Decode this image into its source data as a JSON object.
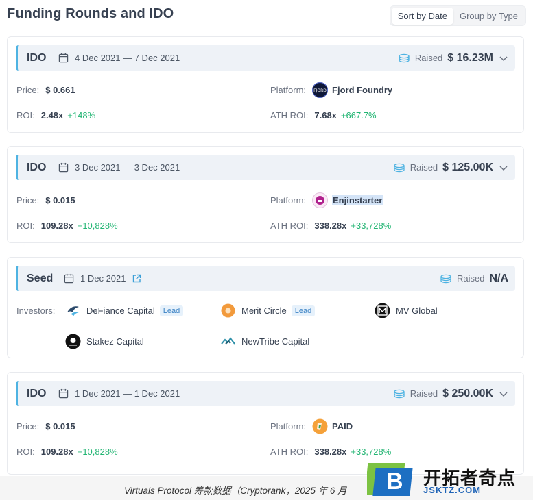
{
  "page": {
    "title": "Funding Rounds and IDO",
    "sort_by_date": "Sort by Date",
    "group_by_type": "Group by Type"
  },
  "rounds": [
    {
      "type": "IDO",
      "date": "4 Dec 2021 — 7 Dec 2021",
      "raised_label": "Raised",
      "raised_value": "$ 16.23M",
      "price_label": "Price:",
      "price": "$ 0.661",
      "platform_label": "Platform:",
      "platform": "Fjord Foundry",
      "roi_label": "ROI:",
      "roi": "2.48x",
      "roi_pct": "+148%",
      "ath_label": "ATH ROI:",
      "ath_roi": "7.68x",
      "ath_pct": "+667.7%"
    },
    {
      "type": "IDO",
      "date": "3 Dec 2021 — 3 Dec 2021",
      "raised_label": "Raised",
      "raised_value": "$ 125.00K",
      "price_label": "Price:",
      "price": "$ 0.015",
      "platform_label": "Platform:",
      "platform": "Enjinstarter",
      "roi_label": "ROI:",
      "roi": "109.28x",
      "roi_pct": "+10,828%",
      "ath_label": "ATH ROI:",
      "ath_roi": "338.28x",
      "ath_pct": "+33,728%"
    },
    {
      "type": "Seed",
      "date": "1 Dec 2021",
      "raised_label": "Raised",
      "raised_value": "N/A",
      "investors_label": "Investors:",
      "lead_label": "Lead",
      "investors": [
        "DeFiance Capital",
        "Merit Circle",
        "MV Global",
        "Stakez Capital",
        "NewTribe Capital"
      ]
    },
    {
      "type": "IDO",
      "date": "1 Dec 2021 — 1 Dec 2021",
      "raised_label": "Raised",
      "raised_value": "$ 250.00K",
      "price_label": "Price:",
      "price": "$ 0.015",
      "platform_label": "Platform:",
      "platform": "PAID",
      "roi_label": "ROI:",
      "roi": "109.28x",
      "roi_pct": "+10,828%",
      "ath_label": "ATH ROI:",
      "ath_roi": "338.28x",
      "ath_pct": "+33,728%"
    }
  ],
  "footer": {
    "caption": "Virtuals Protocol 筹款数据（Cryptorank，2025 年 6 月",
    "watermark_title": "开拓者奇点",
    "watermark_sub": "JSKTZ.COM",
    "watermark_letter": "B"
  },
  "colors": {
    "accent": "#4eb3e2",
    "positive": "#22b573",
    "bar_bg": "#eef2f7",
    "lead_text": "#3b82c4"
  }
}
